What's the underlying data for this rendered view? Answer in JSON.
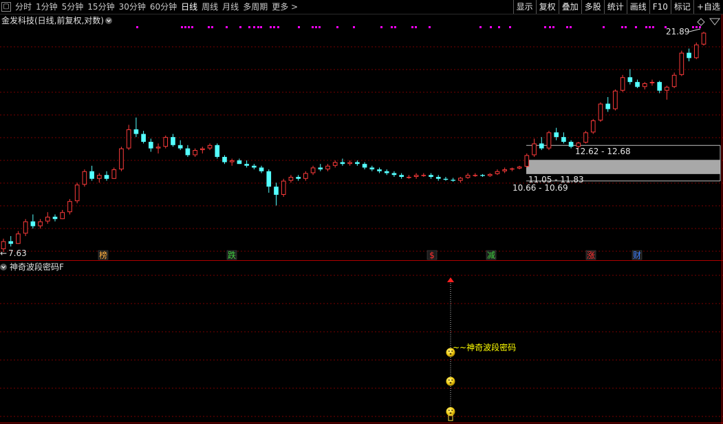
{
  "toolbar": {
    "menu_glyph": "▢",
    "period_tabs": [
      "分时",
      "1分钟",
      "5分钟",
      "15分钟",
      "30分钟",
      "60分钟",
      "日线",
      "周线",
      "月线",
      "多周期",
      "更多 >"
    ],
    "active_tab": "日线",
    "right_buttons": [
      "显示",
      "复权",
      "叠加",
      "多股",
      "统计",
      "画线",
      "F10",
      "标记",
      "+自选"
    ]
  },
  "main_panel": {
    "title": "金发科技(日线,前复权,对数)",
    "high_label": "21.89",
    "low_label": "7.63",
    "zone_labels": [
      "12.62 - 12.68",
      "11.05 - 11.83",
      "10.66 - 10.69"
    ],
    "event_markers": [
      {
        "text": "榜",
        "color": "#ffb040"
      },
      {
        "text": "跌",
        "color": "#40d040"
      },
      {
        "text": "$",
        "color": "#ff3030"
      },
      {
        "text": "减",
        "color": "#40d040"
      },
      {
        "text": "涨",
        "color": "#ff3030"
      },
      {
        "text": "财",
        "color": "#4080ff"
      }
    ]
  },
  "indicator_panel": {
    "title": "神奇波段密码F",
    "signal_label": "~~神奇波段密码"
  },
  "colors": {
    "up": "#ff3b3b",
    "down": "#54ffff",
    "grid": "#7a0000",
    "border": "#b00000",
    "signal_dots": "#ff00ff",
    "label": "#ffff00",
    "zone_fill": "#a8a8a8"
  },
  "chart_data": {
    "type": "candlestick",
    "y_scale": "log",
    "ylim": [
      7.4,
      22.5
    ],
    "candles": [
      [
        7.7,
        8.1,
        7.6,
        8.0
      ],
      [
        8.0,
        8.2,
        7.8,
        7.9
      ],
      [
        7.9,
        8.4,
        7.9,
        8.3
      ],
      [
        8.3,
        8.9,
        8.2,
        8.8
      ],
      [
        8.8,
        9.1,
        8.5,
        8.6
      ],
      [
        8.6,
        8.9,
        8.5,
        8.8
      ],
      [
        8.8,
        9.2,
        8.7,
        9.0
      ],
      [
        9.0,
        9.1,
        8.8,
        8.9
      ],
      [
        8.9,
        9.3,
        8.9,
        9.2
      ],
      [
        9.2,
        9.8,
        9.1,
        9.7
      ],
      [
        9.7,
        10.6,
        9.6,
        10.5
      ],
      [
        10.5,
        11.3,
        10.4,
        11.2
      ],
      [
        11.2,
        11.5,
        10.7,
        10.8
      ],
      [
        10.8,
        11.1,
        10.6,
        11.0
      ],
      [
        11.0,
        11.2,
        10.7,
        10.8
      ],
      [
        10.8,
        11.4,
        10.8,
        11.3
      ],
      [
        11.3,
        12.6,
        11.2,
        12.5
      ],
      [
        12.5,
        14.0,
        12.4,
        13.7
      ],
      [
        13.7,
        14.5,
        13.2,
        13.4
      ],
      [
        13.4,
        13.6,
        12.8,
        12.9
      ],
      [
        12.9,
        13.1,
        12.3,
        12.5
      ],
      [
        12.5,
        12.8,
        12.2,
        12.6
      ],
      [
        12.6,
        13.3,
        12.5,
        13.2
      ],
      [
        13.2,
        13.4,
        12.6,
        12.7
      ],
      [
        12.7,
        13.0,
        12.4,
        12.5
      ],
      [
        12.5,
        12.7,
        12.0,
        12.1
      ],
      [
        12.1,
        12.5,
        12.0,
        12.4
      ],
      [
        12.4,
        12.6,
        12.2,
        12.5
      ],
      [
        12.5,
        12.8,
        12.4,
        12.7
      ],
      [
        12.7,
        12.8,
        11.9,
        12.0
      ],
      [
        12.0,
        12.1,
        11.6,
        11.7
      ],
      [
        11.7,
        11.9,
        11.5,
        11.8
      ],
      [
        11.8,
        11.9,
        11.6,
        11.6
      ],
      [
        11.6,
        11.8,
        11.4,
        11.5
      ],
      [
        11.5,
        11.6,
        11.3,
        11.4
      ],
      [
        11.4,
        11.5,
        11.1,
        11.2
      ],
      [
        11.2,
        11.3,
        10.1,
        10.4
      ],
      [
        10.4,
        10.6,
        9.5,
        10.0
      ],
      [
        10.0,
        10.8,
        9.9,
        10.7
      ],
      [
        10.7,
        11.0,
        10.6,
        10.9
      ],
      [
        10.9,
        11.0,
        10.7,
        10.8
      ],
      [
        10.8,
        11.2,
        10.7,
        11.1
      ],
      [
        11.1,
        11.5,
        11.0,
        11.4
      ],
      [
        11.4,
        11.6,
        11.2,
        11.3
      ],
      [
        11.3,
        11.6,
        11.2,
        11.5
      ],
      [
        11.5,
        11.8,
        11.4,
        11.7
      ],
      [
        11.7,
        11.9,
        11.5,
        11.6
      ],
      [
        11.6,
        11.8,
        11.5,
        11.7
      ],
      [
        11.7,
        11.8,
        11.5,
        11.6
      ],
      [
        11.6,
        11.7,
        11.3,
        11.4
      ],
      [
        11.4,
        11.5,
        11.2,
        11.3
      ],
      [
        11.3,
        11.4,
        11.1,
        11.2
      ],
      [
        11.2,
        11.3,
        11.0,
        11.1
      ],
      [
        11.1,
        11.2,
        10.9,
        11.0
      ],
      [
        11.0,
        11.1,
        10.8,
        10.9
      ],
      [
        10.9,
        11.0,
        10.8,
        10.9
      ],
      [
        10.9,
        11.1,
        10.8,
        11.0
      ],
      [
        11.0,
        11.1,
        10.9,
        11.0
      ],
      [
        11.0,
        11.1,
        10.8,
        10.9
      ],
      [
        10.9,
        11.0,
        10.7,
        10.8
      ],
      [
        10.8,
        10.9,
        10.7,
        10.75
      ],
      [
        10.75,
        10.85,
        10.65,
        10.7
      ],
      [
        10.7,
        10.9,
        10.6,
        10.85
      ],
      [
        10.85,
        11.1,
        10.8,
        11.0
      ],
      [
        11.0,
        11.1,
        10.9,
        11.0
      ],
      [
        11.0,
        11.05,
        10.9,
        10.95
      ],
      [
        10.95,
        11.1,
        10.9,
        11.05
      ],
      [
        11.05,
        11.3,
        11.0,
        11.2
      ],
      [
        11.2,
        11.4,
        11.1,
        11.3
      ],
      [
        11.3,
        11.4,
        11.2,
        11.35
      ],
      [
        11.35,
        11.5,
        11.3,
        11.45
      ],
      [
        11.45,
        12.2,
        11.4,
        12.1
      ],
      [
        12.1,
        13.1,
        12.0,
        12.8
      ],
      [
        12.8,
        13.2,
        12.4,
        12.5
      ],
      [
        12.5,
        13.6,
        12.4,
        13.5
      ],
      [
        13.5,
        13.8,
        13.0,
        13.2
      ],
      [
        13.2,
        13.5,
        12.8,
        12.9
      ],
      [
        12.9,
        13.0,
        12.5,
        12.6
      ],
      [
        12.6,
        12.9,
        12.5,
        12.85
      ],
      [
        12.85,
        13.6,
        12.8,
        13.5
      ],
      [
        13.5,
        14.4,
        13.4,
        14.3
      ],
      [
        14.3,
        15.6,
        14.2,
        15.5
      ],
      [
        15.5,
        16.0,
        14.9,
        15.1
      ],
      [
        15.1,
        16.6,
        15.0,
        16.5
      ],
      [
        16.5,
        17.8,
        16.4,
        17.6
      ],
      [
        17.6,
        18.3,
        17.0,
        17.2
      ],
      [
        17.2,
        17.4,
        16.7,
        16.8
      ],
      [
        16.8,
        17.2,
        16.6,
        17.1
      ],
      [
        17.1,
        17.4,
        16.9,
        17.2
      ],
      [
        17.2,
        17.3,
        16.3,
        16.5
      ],
      [
        16.5,
        16.9,
        15.8,
        16.8
      ],
      [
        16.8,
        18.0,
        16.7,
        17.8
      ],
      [
        17.8,
        20.0,
        17.7,
        19.8
      ],
      [
        19.8,
        20.2,
        19.0,
        19.3
      ],
      [
        19.3,
        20.8,
        19.2,
        20.6
      ],
      [
        20.6,
        21.9,
        20.5,
        21.8
      ]
    ]
  }
}
